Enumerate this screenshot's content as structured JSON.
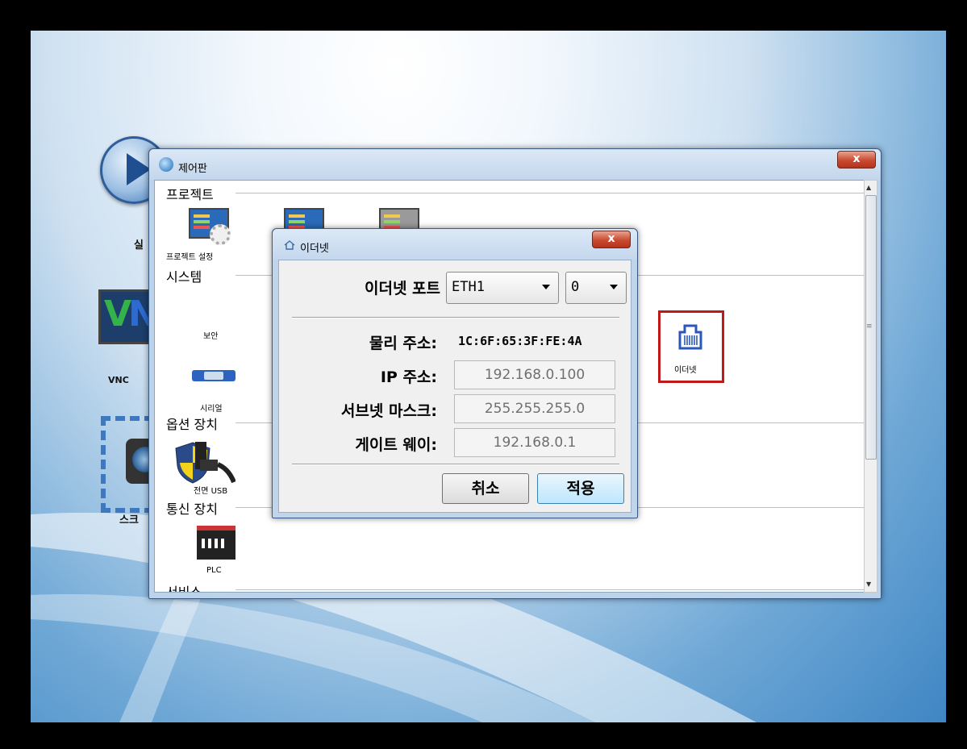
{
  "desktop": {
    "icons": [
      {
        "label": "실"
      },
      {
        "label": "VNC"
      },
      {
        "label": "스크"
      }
    ]
  },
  "control_panel": {
    "title": "제어판",
    "close_label": "x",
    "groups": {
      "project": {
        "label": "프로젝트",
        "items": [
          {
            "label": "프로젝트 설정",
            "icon": "project-settings-icon"
          },
          {
            "label": "",
            "icon": "project-monitor-icon"
          },
          {
            "label": "",
            "icon": "project-monitor-gray-icon"
          }
        ]
      },
      "system": {
        "label": "시스템",
        "items": [
          {
            "label": "보안",
            "icon": "shield-icon"
          },
          {
            "label": "시리얼",
            "icon": "serial-port-icon"
          },
          {
            "label": "이더넷",
            "icon": "ethernet-port-icon"
          }
        ]
      },
      "options": {
        "label": "옵션 장치",
        "items": [
          {
            "label": "전면 USB",
            "icon": "usb-icon"
          }
        ]
      },
      "comm": {
        "label": "통신 장치",
        "items": [
          {
            "label": "PLC",
            "icon": "plc-icon"
          }
        ]
      },
      "service": {
        "label": "서비스"
      }
    }
  },
  "ethernet_dialog": {
    "title": "이더넷",
    "close_label": "x",
    "port_label": "이더넷 포트",
    "port_value": "ETH1",
    "index_value": "0",
    "mac_label": "물리 주소:",
    "mac_value": "1C:6F:65:3F:FE:4A",
    "ip_label": "IP 주소:",
    "ip_value": "192.168.0.100",
    "mask_label": "서브넷 마스크:",
    "mask_value": "255.255.255.0",
    "gateway_label": "게이트 웨이:",
    "gateway_value": "192.168.0.1",
    "cancel_label": "취소",
    "apply_label": "적용"
  },
  "colors": {
    "highlight_border": "#c0191a",
    "title_bar": "#c3d6ec",
    "close_button": "#c84a30"
  }
}
